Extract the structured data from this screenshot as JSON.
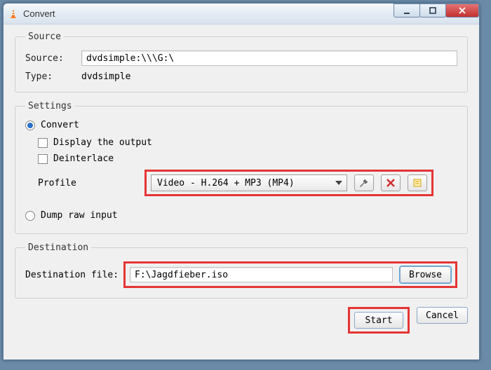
{
  "window": {
    "title": "Convert"
  },
  "source_group": {
    "legend": "Source",
    "source_label": "Source:",
    "source_value": "dvdsimple:\\\\\\G:\\",
    "type_label": "Type:",
    "type_value": "dvdsimple"
  },
  "settings_group": {
    "legend": "Settings",
    "convert_label": "Convert",
    "display_output_label": "Display the output",
    "deinterlace_label": "Deinterlace",
    "profile_label": "Profile",
    "profile_value": "Video - H.264 + MP3 (MP4)",
    "dump_label": "Dump raw input",
    "convert_checked": true,
    "display_output_checked": false,
    "deinterlace_checked": false,
    "dump_checked": false
  },
  "destination_group": {
    "legend": "Destination",
    "dest_label": "Destination file:",
    "dest_value": "F:\\Jagdfieber.iso",
    "browse_label": "Browse"
  },
  "buttons": {
    "start": "Start",
    "cancel": "Cancel"
  }
}
